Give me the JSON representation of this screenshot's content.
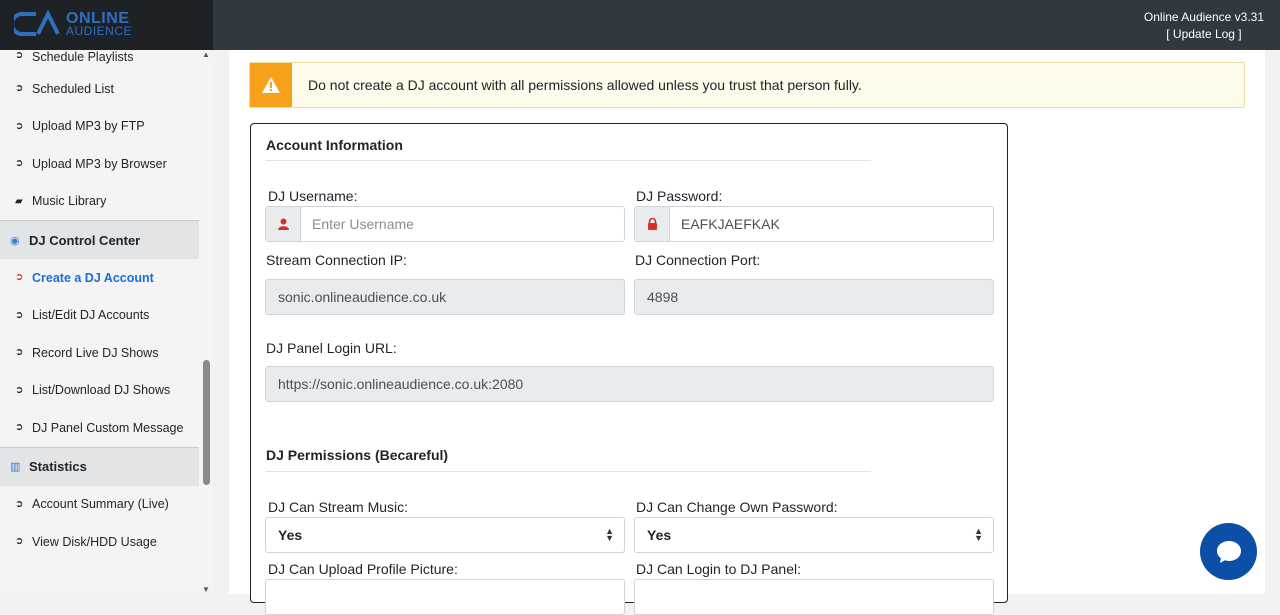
{
  "brand": {
    "line1": "ONLINE",
    "line2": "AUDIENCE"
  },
  "header": {
    "version": "Online Audience v3.31",
    "update_log": "[ Update Log ]"
  },
  "sidebar": {
    "items": [
      {
        "label": "Schedule Playlists",
        "icon": "circle-arrow-right-icon"
      },
      {
        "label": "Scheduled List",
        "icon": "circle-arrow-right-icon"
      },
      {
        "label": "Upload MP3 by FTP",
        "icon": "circle-arrow-right-icon"
      },
      {
        "label": "Upload MP3 by Browser",
        "icon": "circle-arrow-right-icon"
      },
      {
        "label": "Music Library",
        "icon": "folder-open-icon"
      }
    ],
    "dj_header": "DJ Control Center",
    "dj_items": [
      {
        "label": "Create a DJ Account",
        "active": true
      },
      {
        "label": "List/Edit DJ Accounts"
      },
      {
        "label": "Record Live DJ Shows"
      },
      {
        "label": "List/Download DJ Shows"
      },
      {
        "label": "DJ Panel Custom Message"
      }
    ],
    "stats_header": "Statistics",
    "stats_items": [
      {
        "label": "Account Summary (Live)"
      },
      {
        "label": "View Disk/HDD Usage"
      }
    ]
  },
  "alert": {
    "text": "Do not create a DJ account with all permissions allowed unless you trust that person fully.",
    "color": "#f7a11a"
  },
  "account": {
    "title": "Account Information",
    "username_label": "DJ Username:",
    "username_placeholder": "Enter Username",
    "password_label": "DJ Password:",
    "password_value": "EAFKJAEFKAK",
    "ip_label": "Stream Connection IP:",
    "ip_value": "sonic.onlineaudience.co.uk",
    "port_label": "DJ Connection Port:",
    "port_value": "4898",
    "url_label": "DJ Panel Login URL:",
    "url_value": "https://sonic.onlineaudience.co.uk:2080"
  },
  "permissions": {
    "title": "DJ Permissions (Becareful)",
    "stream_label": "DJ Can Stream Music:",
    "stream_value": "Yes",
    "change_pw_label": "DJ Can Change Own Password:",
    "change_pw_value": "Yes",
    "upload_pic_label": "DJ Can Upload Profile Picture:",
    "login_label": "DJ Can Login to DJ Panel:"
  }
}
